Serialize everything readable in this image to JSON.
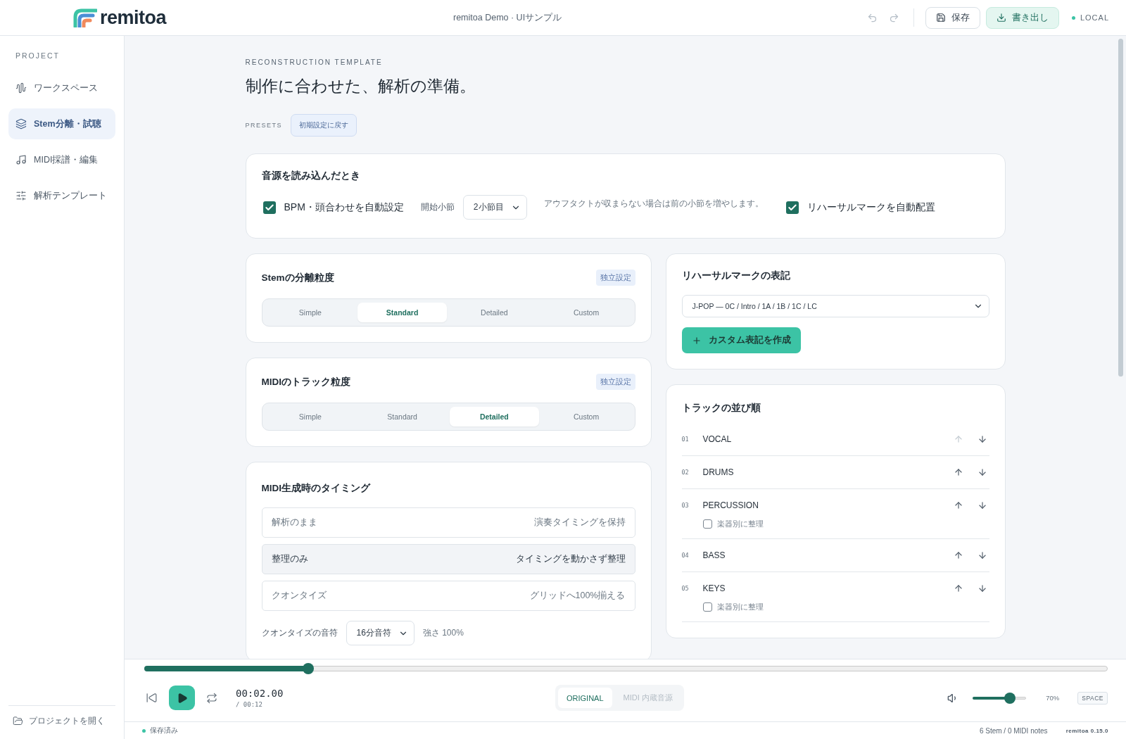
{
  "header": {
    "brand": "remitoa",
    "title": "remitoa Demo · UIサンプル",
    "buttons": [
      {
        "label": "保存",
        "kind": "save"
      },
      {
        "label": "書き出し",
        "kind": "export"
      }
    ],
    "status": "LOCAL"
  },
  "sidebar": {
    "section": "PROJECT",
    "items": [
      {
        "label": "ワークスペース",
        "selected": false
      },
      {
        "label": "Stem分離・試聴",
        "selected": true
      },
      {
        "label": "MIDI採譜・編集",
        "selected": false
      },
      {
        "label": "解析テンプレート",
        "selected": false
      }
    ],
    "open_project": "プロジェクトを開く"
  },
  "page": {
    "eyebrow": "RECONSTRUCTION TEMPLATE",
    "title": "制作に合わせた、解析の準備。",
    "presets_label": "PRESETS",
    "reset_button": "初期設定に戻す"
  },
  "import_card": {
    "title": "音源を読み込んだとき",
    "auto_bpm": {
      "label": "BPM・頭合わせを自動設定",
      "checked": true
    },
    "start_bar": {
      "label": "開始小節",
      "value": "2小節目"
    },
    "hint": "アウフタクトが収まらない場合は前の小節を増やします。",
    "auto_marks": {
      "label": "リハーサルマークを自動配置",
      "checked": true
    }
  },
  "stem_card": {
    "title": "Stemの分離粒度",
    "badge": "独立設定",
    "options": [
      {
        "label": "Simple",
        "selected": false
      },
      {
        "label": "Standard",
        "selected": true
      },
      {
        "label": "Detailed",
        "selected": false
      },
      {
        "label": "Custom",
        "selected": false
      }
    ]
  },
  "midi_track_card": {
    "title": "MIDIのトラック粒度",
    "badge": "独立設定",
    "options": [
      {
        "label": "Simple",
        "selected": false
      },
      {
        "label": "Standard",
        "selected": false
      },
      {
        "label": "Detailed",
        "selected": true
      },
      {
        "label": "Custom",
        "selected": false
      }
    ]
  },
  "timing_card": {
    "title": "MIDI生成時のタイミング",
    "options": [
      {
        "label": "解析のまま",
        "description": "演奏タイミングを保持",
        "selected": false
      },
      {
        "label": "整理のみ",
        "description": "タイミングを動かさず整理",
        "selected": true
      },
      {
        "label": "クオンタイズ",
        "description": "グリッドへ100%揃える",
        "selected": false
      }
    ],
    "quantize_note": {
      "label": "クオンタイズの音符",
      "value": "16分音符"
    },
    "strength": "強さ 100%"
  },
  "rehearsal_card": {
    "title": "リハーサルマークの表記",
    "value": "J-POP — 0C / Intro / 1A / 1B / 1C / LC",
    "create_button": "カスタム表記を作成"
  },
  "track_order": {
    "title": "トラックの並び順",
    "tracks": [
      {
        "number": "01",
        "name": "VOCAL",
        "up_disabled": true
      },
      {
        "number": "02",
        "name": "DRUMS",
        "up_disabled": false
      },
      {
        "number": "03",
        "name": "PERCUSSION",
        "up_disabled": false,
        "group_option": {
          "label": "楽器別に整理",
          "checked": false
        }
      },
      {
        "number": "04",
        "name": "BASS",
        "up_disabled": false
      },
      {
        "number": "05",
        "name": "KEYS",
        "up_disabled": false,
        "group_option": {
          "label": "楽器別に整理",
          "checked": false
        }
      }
    ]
  },
  "player": {
    "level": 0.17,
    "time": "00:02.00",
    "duration": "/ 00:12",
    "sources": [
      {
        "label": "ORIGINAL",
        "selected": true
      },
      {
        "label": "MIDI 内蔵音源",
        "selected": false
      }
    ],
    "volume": {
      "level": 0.7,
      "reading": "70%"
    },
    "shortcut": "SPACE"
  },
  "status_bar": {
    "saved": "保存済み",
    "counts": "6 Stem / 0 MIDI notes",
    "version": "remitoa 0.15.0"
  }
}
